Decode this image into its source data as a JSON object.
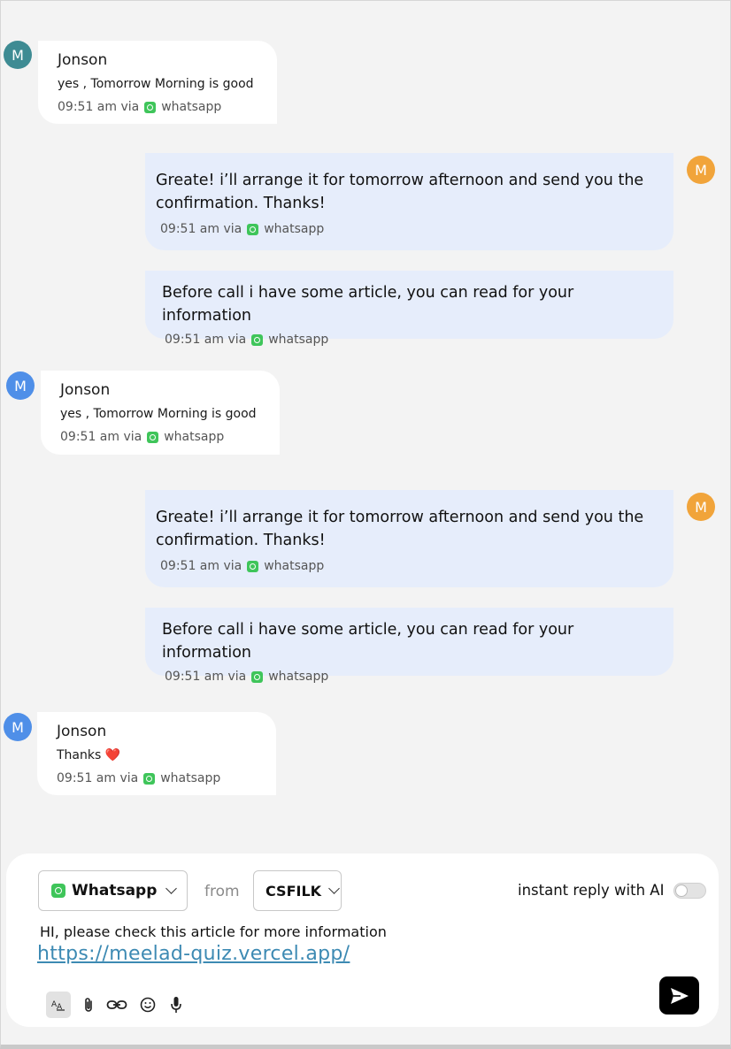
{
  "messages": [
    {
      "sender": "Jonson",
      "avatar": "M",
      "text": "yes , Tomorrow Morning is good",
      "time": "09:51 am via",
      "channel": "whatsapp"
    },
    {
      "avatar": "M",
      "text": "Greate! i’ll arrange it for tomorrow afternoon and send you the confirmation. Thanks!",
      "time": "09:51 am via",
      "channel": "whatsapp"
    },
    {
      "text": "Before call i have some article, you can read for your information",
      "time": "09:51 am via",
      "channel": "whatsapp"
    },
    {
      "sender": "Jonson",
      "avatar": "M",
      "text": "yes , Tomorrow Morning is good",
      "time": "09:51 am via",
      "channel": "whatsapp"
    },
    {
      "avatar": "M",
      "text": "Greate! i’ll arrange it for tomorrow afternoon and send you the confirmation. Thanks!",
      "time": "09:51 am via",
      "channel": "whatsapp"
    },
    {
      "text": "Before call i have some article, you can read for your information",
      "time": "09:51 am via",
      "channel": "whatsapp"
    },
    {
      "sender": "Jonson",
      "avatar": "M",
      "text": "Thanks ❤️",
      "time": "09:51 am via",
      "channel": "whatsapp"
    }
  ],
  "composer": {
    "channel_label": "Whatsapp",
    "from_label": "from",
    "sender_label": "CSFILK",
    "ai_label": "instant reply with AI",
    "ai_enabled": false,
    "message_text": "HI, please check this article for more information",
    "message_link": "https://meelad-quiz.vercel.app/"
  },
  "colors": {
    "incoming_bubble": "#ffffff",
    "outgoing_bubble": "#e6edfb",
    "avatar_teal": "#3e8b93",
    "avatar_blue": "#4f8fe8",
    "avatar_orange": "#f1a43a",
    "link": "#3d8ab3",
    "whatsapp": "#3fc55a"
  },
  "icons": [
    "whatsapp-icon",
    "text-format-icon",
    "paperclip-icon",
    "link-icon",
    "emoji-icon",
    "microphone-icon",
    "send-icon",
    "chevron-down-icon"
  ]
}
